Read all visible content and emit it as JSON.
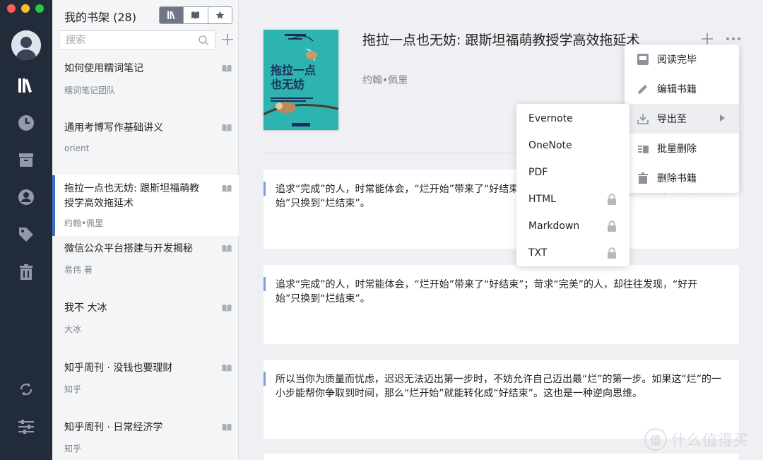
{
  "sidebar": {
    "nav": [
      "library-icon",
      "clock-icon",
      "archive-icon",
      "user-icon",
      "tag-icon",
      "trash-icon",
      "sync-icon",
      "settings-sliders-icon"
    ]
  },
  "list": {
    "title": "我的书架 (28)",
    "search_placeholder": "搜索",
    "books": [
      {
        "title": "如何使用糯词笔记",
        "author": "糯词笔记团队"
      },
      {
        "title": "通用考博写作基础讲义",
        "author": "orient"
      },
      {
        "title": "拖拉一点也无妨: 跟斯坦福萌教授学高效拖延术",
        "author": "约翰•佩里"
      },
      {
        "title": "微信公众平台搭建与开发揭秘",
        "author": "易伟 著"
      },
      {
        "title": "我不 大冰",
        "author": "大冰"
      },
      {
        "title": "知乎周刊 · 没钱也要理财",
        "author": "知乎"
      },
      {
        "title": "知乎周刊 · 日常经济学",
        "author": "知乎"
      }
    ]
  },
  "book": {
    "title": "拖拉一点也无妨: 跟斯坦福萌教授学高效拖延术",
    "author": "约翰•佩里",
    "cover_title": "拖拉一点\n也无妨",
    "cover_color": "#2db3b0"
  },
  "notes": [
    "追求“完成”的人，时常能体会，“烂开始”带来了“好结束”；苛求“完美”的人，却往往发现，“好开始”只换到“烂结束”。",
    "追求“完成”的人，时常能体会，“烂开始”带来了“好结束”；苛求“完美”的人，却往往发现，“好开始”只换到“烂结束”。",
    "所以当你为质量而忧虑，迟迟无法迈出第一步时，不妨允许自己迈出最“烂”的第一步。如果这“烂”的一小步能帮你争取到时间，那么“烂开始”就能转化成“好结束”。这也是一种逆向思维。"
  ],
  "menu": {
    "items": [
      {
        "label": "阅读完毕",
        "icon": "finish-reading-icon"
      },
      {
        "label": "编辑书籍",
        "icon": "pencil-icon"
      },
      {
        "label": "导出至",
        "icon": "export-icon"
      },
      {
        "label": "批量删除",
        "icon": "batch-delete-icon"
      },
      {
        "label": "删除书籍",
        "icon": "trash-icon"
      }
    ],
    "export": [
      {
        "label": "Evernote",
        "locked": false
      },
      {
        "label": "OneNote",
        "locked": false
      },
      {
        "label": "PDF",
        "locked": false
      },
      {
        "label": "HTML",
        "locked": true
      },
      {
        "label": "Markdown",
        "locked": true
      },
      {
        "label": "TXT",
        "locked": true
      }
    ]
  },
  "watermark": {
    "text": "什么值得买",
    "badge": "值"
  },
  "colors": {
    "rail": "#222b39",
    "accent": "#3b6fd0",
    "quote_bar": "#7b9fe0"
  }
}
